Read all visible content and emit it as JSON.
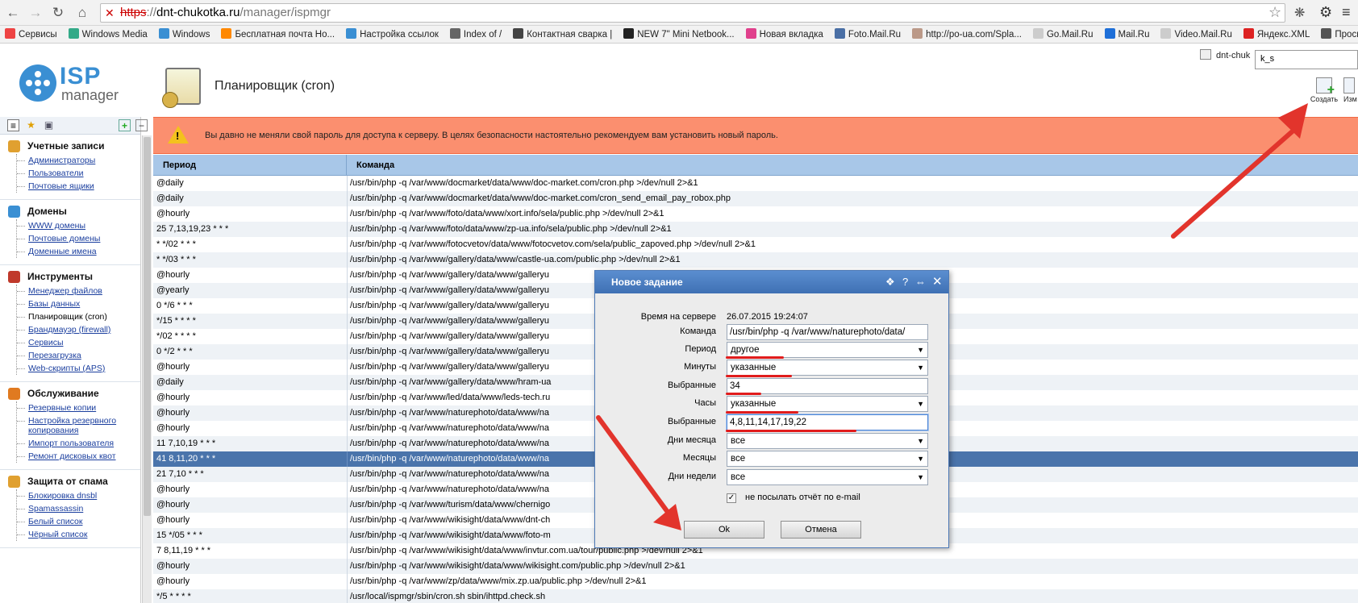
{
  "browser": {
    "url_protocol": "https",
    "url_host": "dnt-chukotka.ru",
    "url_path": "/manager/ispmgr",
    "bookmarks": [
      {
        "label": "Сервисы",
        "icon": "apps-icon",
        "color": "#e44"
      },
      {
        "label": "Windows Media",
        "icon": "windows-media-icon",
        "color": "#3a8"
      },
      {
        "label": "Windows",
        "icon": "windows-icon",
        "color": "#3a8fd3"
      },
      {
        "label": "Бесплатная почта Но...",
        "icon": "hotmail-icon",
        "color": "#f80"
      },
      {
        "label": "Настройка ссылок",
        "icon": "windows-icon",
        "color": "#3a8fd3"
      },
      {
        "label": "Index of /",
        "icon": "index-icon",
        "color": "#666"
      },
      {
        "label": "Контактная сварка |",
        "icon": "weld-icon",
        "color": "#444"
      },
      {
        "label": "NEW 7\" Mini Netbook...",
        "icon": "netbook-icon",
        "color": "#222"
      },
      {
        "label": "Новая вкладка",
        "icon": "flickr-icon",
        "color": "#e0408c"
      },
      {
        "label": "Foto.Mail.Ru",
        "icon": "foto-mail-icon",
        "color": "#4a6fa5"
      },
      {
        "label": "http://po-ua.com/Spla...",
        "icon": "po-ua-icon",
        "color": "#b98"
      },
      {
        "label": "Go.Mail.Ru",
        "icon": "page-icon",
        "color": "#ccc"
      },
      {
        "label": "Mail.Ru",
        "icon": "mail-ru-icon",
        "color": "#1e6fd8"
      },
      {
        "label": "Video.Mail.Ru",
        "icon": "page-icon",
        "color": "#ccc"
      },
      {
        "label": "Яндекс.XML",
        "icon": "yandex-icon",
        "color": "#d22"
      },
      {
        "label": "Просмотр",
        "icon": "view-icon",
        "color": "#555"
      }
    ]
  },
  "header": {
    "logo_isp": "ISP",
    "logo_manager": "manager",
    "page_title": "Планировщик (cron)",
    "tab_label": "dnt-chuk",
    "search_value": "k_s",
    "create_label": "Создать",
    "edit_label": "Изм"
  },
  "sidebar": {
    "groups": [
      {
        "title": "Учетные записи",
        "icon": "accounts-icon",
        "color": "#e0a030",
        "items": [
          "Администраторы",
          "Пользователи",
          "Почтовые ящики"
        ]
      },
      {
        "title": "Домены",
        "icon": "domains-icon",
        "color": "#3a8fd3",
        "items": [
          "WWW домены",
          "Почтовые домены",
          "Доменные имена"
        ]
      },
      {
        "title": "Инструменты",
        "icon": "tools-icon",
        "color": "#c0392b",
        "items": [
          "Менеджер файлов",
          "Базы данных",
          "Планировщик (cron)",
          "Брандмауэр (firewall)",
          "Сервисы",
          "Перезагрузка",
          "Web-скрипты (APS)"
        ]
      },
      {
        "title": "Обслуживание",
        "icon": "maintenance-icon",
        "color": "#e07a20",
        "items": [
          "Резервные копии",
          "Настройка резервного копирования",
          "Импорт пользователя",
          "Ремонт дисковых квот"
        ]
      },
      {
        "title": "Защита от спама",
        "icon": "spam-icon",
        "color": "#e0a030",
        "items": [
          "Блокировка dnsbl",
          "Spamassassin",
          "Белый список",
          "Чёрный список"
        ]
      }
    ]
  },
  "warning": {
    "text": "Вы давно не меняли свой пароль для доступа к серверу. В целях безопасности настоятельно рекомендуем вам установить новый пароль."
  },
  "table": {
    "headers": [
      "Период",
      "Команда"
    ],
    "rows": [
      [
        "@daily",
        "/usr/bin/php -q /var/www/docmarket/data/www/doc-market.com/cron.php >/dev/null 2>&1"
      ],
      [
        "@daily",
        "/usr/bin/php -q /var/www/docmarket/data/www/doc-market.com/cron_send_email_pay_robox.php"
      ],
      [
        "@hourly",
        "/usr/bin/php -q /var/www/foto/data/www/xort.info/sela/public.php >/dev/null 2>&1"
      ],
      [
        "25 7,13,19,23 * * *",
        "/usr/bin/php -q /var/www/foto/data/www/zp-ua.info/sela/public.php >/dev/null 2>&1"
      ],
      [
        "* */02 * * *",
        "/usr/bin/php -q /var/www/fotocvetov/data/www/fotocvetov.com/sela/public_zapoved.php >/dev/null 2>&1"
      ],
      [
        "* */03 * * *",
        "/usr/bin/php -q /var/www/gallery/data/www/castle-ua.com/public.php >/dev/null 2>&1"
      ],
      [
        "@hourly",
        "/usr/bin/php -q /var/www/gallery/data/www/galleryu"
      ],
      [
        "@yearly",
        "/usr/bin/php -q /var/www/gallery/data/www/galleryu"
      ],
      [
        "0 */6 * * *",
        "/usr/bin/php -q /var/www/gallery/data/www/galleryu"
      ],
      [
        "*/15 * * * *",
        "/usr/bin/php -q /var/www/gallery/data/www/galleryu"
      ],
      [
        "*/02 * * * *",
        "/usr/bin/php -q /var/www/gallery/data/www/galleryu"
      ],
      [
        "0 */2 * * *",
        "/usr/bin/php -q /var/www/gallery/data/www/galleryu"
      ],
      [
        "@hourly",
        "/usr/bin/php -q /var/www/gallery/data/www/galleryu"
      ],
      [
        "@daily",
        "/usr/bin/php -q /var/www/gallery/data/www/hram-ua"
      ],
      [
        "@hourly",
        "/usr/bin/php -q /var/www/led/data/www/leds-tech.ru"
      ],
      [
        "@hourly",
        "/usr/bin/php -q /var/www/naturephoto/data/www/na"
      ],
      [
        "@hourly",
        "/usr/bin/php -q /var/www/naturephoto/data/www/na"
      ],
      [
        "11 7,10,19 * * *",
        "/usr/bin/php -q /var/www/naturephoto/data/www/na"
      ],
      [
        "41 8,11,20 * * *",
        "/usr/bin/php -q /var/www/naturephoto/data/www/na"
      ],
      [
        "21 7,10 * * *",
        "/usr/bin/php -q /var/www/naturephoto/data/www/na"
      ],
      [
        "@hourly",
        "/usr/bin/php -q /var/www/naturephoto/data/www/na"
      ],
      [
        "@hourly",
        "/usr/bin/php -q /var/www/turism/data/www/chernigo"
      ],
      [
        "@hourly",
        "/usr/bin/php -q /var/www/wikisight/data/www/dnt-ch"
      ],
      [
        "15 */05 * * *",
        "/usr/bin/php -q /var/www/wikisight/data/www/foto-m"
      ],
      [
        "7 8,11,19 * * *",
        "/usr/bin/php -q /var/www/wikisight/data/www/invtur.com.ua/tour/public.php >/dev/null 2>&1"
      ],
      [
        "@hourly",
        "/usr/bin/php -q /var/www/wikisight/data/www/wikisight.com/public.php >/dev/null 2>&1"
      ],
      [
        "@hourly",
        "/usr/bin/php -q /var/www/zp/data/www/mix.zp.ua/public.php >/dev/null 2>&1"
      ],
      [
        "*/5 * * * *",
        "/usr/local/ispmgr/sbin/cron.sh sbin/ihttpd.check.sh"
      ]
    ],
    "selected_index": 18
  },
  "dialog": {
    "title": "Новое задание",
    "server_time_label": "Время на сервере",
    "server_time": "26.07.2015 19:24:07",
    "command_label": "Команда",
    "command_value": "/usr/bin/php -q /var/www/naturephoto/data/",
    "period_label": "Период",
    "period_value": "другое",
    "minutes_label": "Минуты",
    "minutes_value": "указанные",
    "selected_min_label": "Выбранные",
    "selected_min_value": "34",
    "hours_label": "Часы",
    "hours_value": "указанные",
    "selected_hours_label": "Выбранные",
    "selected_hours_value": "4,8,11,14,17,19,22",
    "days_month_label": "Дни месяца",
    "days_month_value": "все",
    "months_label": "Месяцы",
    "months_value": "все",
    "weekdays_label": "Дни недели",
    "weekdays_value": "все",
    "no_email_label": "не посылать отчёт по e-mail",
    "ok_label": "Ok",
    "cancel_label": "Отмена"
  }
}
